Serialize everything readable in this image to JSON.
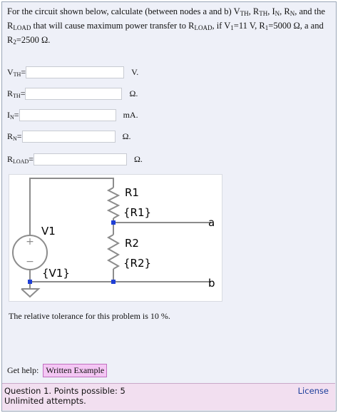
{
  "question": {
    "p1": "For the circuit shown below, calculate (between nodes a and b) V",
    "s1": "TH",
    "p2": ", R",
    "s2": "TH",
    "p3": ", I",
    "s3": "N",
    "p4": ", R",
    "s4": "N",
    "p5": ", and the R",
    "s5": "LOAD",
    "p6": " that will cause maximum power transfer to R",
    "s6": "LOAD",
    "p7": ", if V",
    "s7": "1",
    "p8": "=11 V, R",
    "s8": "1",
    "p9": "=5000 Ω, a and R",
    "s9": "2",
    "p10": "=2500 Ω."
  },
  "answers": [
    {
      "base": "V",
      "sub": "TH",
      "eq": "=",
      "value": "",
      "unit": "V."
    },
    {
      "base": "R",
      "sub": "TH",
      "eq": "=",
      "value": "",
      "unit": "Ω."
    },
    {
      "base": "I",
      "sub": "N",
      "eq": "=",
      "value": "",
      "unit": "mA."
    },
    {
      "base": "R",
      "sub": "N",
      "eq": "=",
      "value": "",
      "unit": "Ω."
    },
    {
      "base": "R",
      "sub": "LOAD",
      "eq": "=",
      "value": "",
      "unit": "Ω."
    }
  ],
  "circuit": {
    "r1": "R1",
    "r1_param": "{R1}",
    "r2": "R2",
    "r2_param": "{R2}",
    "v1": "V1",
    "v1_param": "{V1}",
    "node_a": "a",
    "node_b": "b",
    "plus": "+",
    "minus": "−",
    "wire_color": "#8c8c8c",
    "node_color": "#1f3fd6"
  },
  "tolerance": "The relative tolerance for this problem is 10 %.",
  "help": {
    "label": "Get help:",
    "button": "Written Example"
  },
  "footer": {
    "question_line": "Question 1. Points possible: 5",
    "attempts_line": "Unlimited attempts.",
    "license": "License"
  }
}
